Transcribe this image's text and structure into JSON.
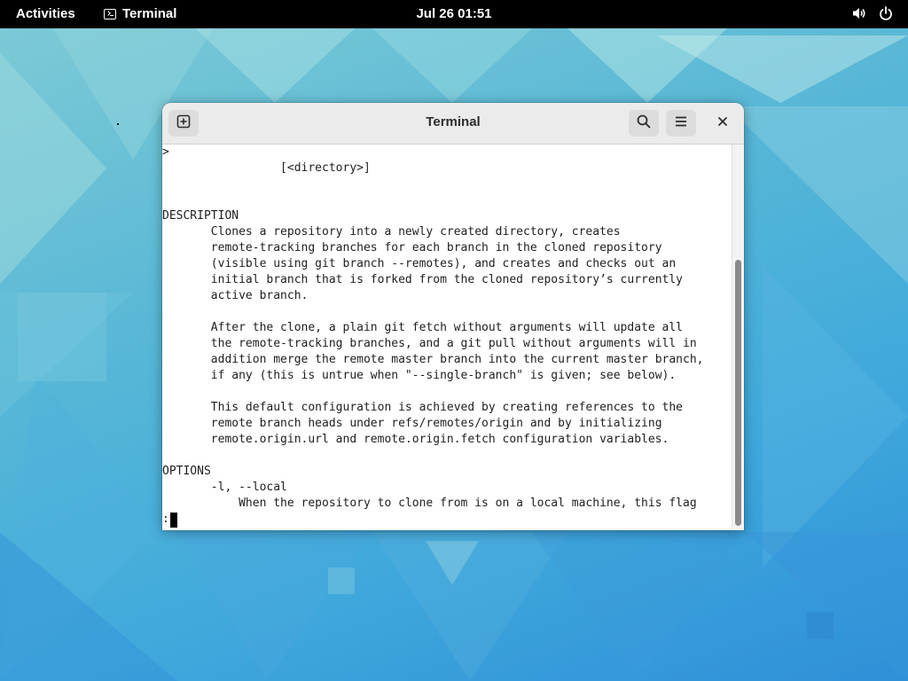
{
  "topbar": {
    "activities": "Activities",
    "app_name": "Terminal",
    "clock": "Jul 26  01:51",
    "icons": [
      "volume-icon",
      "power-icon"
    ]
  },
  "window": {
    "title": "Terminal",
    "buttons": [
      "new-tab-icon",
      "search-icon",
      "hamburger-menu-icon",
      "close-icon"
    ]
  },
  "terminal": {
    "lines": [
      ">",
      "                 [<directory>]",
      "",
      "",
      "DESCRIPTION",
      "       Clones a repository into a newly created directory, creates",
      "       remote-tracking branches for each branch in the cloned repository",
      "       (visible using git branch --remotes), and creates and checks out an",
      "       initial branch that is forked from the cloned repository’s currently",
      "       active branch.",
      "",
      "       After the clone, a plain git fetch without arguments will update all",
      "       the remote-tracking branches, and a git pull without arguments will in",
      "       addition merge the remote master branch into the current master branch,",
      "       if any (this is untrue when \"--single-branch\" is given; see below).",
      "",
      "       This default configuration is achieved by creating references to the",
      "       remote branch heads under refs/remotes/origin and by initializing",
      "       remote.origin.url and remote.origin.fetch configuration variables.",
      "",
      "OPTIONS",
      "       -l, --local",
      "           When the repository to clone from is on a local machine, this flag"
    ],
    "prompt": ":"
  },
  "colors": {
    "topbar_bg": "#000000",
    "headerbar_bg": "#ebebeb",
    "terminal_bg": "#ffffff",
    "terminal_fg": "#1e1e1e"
  }
}
